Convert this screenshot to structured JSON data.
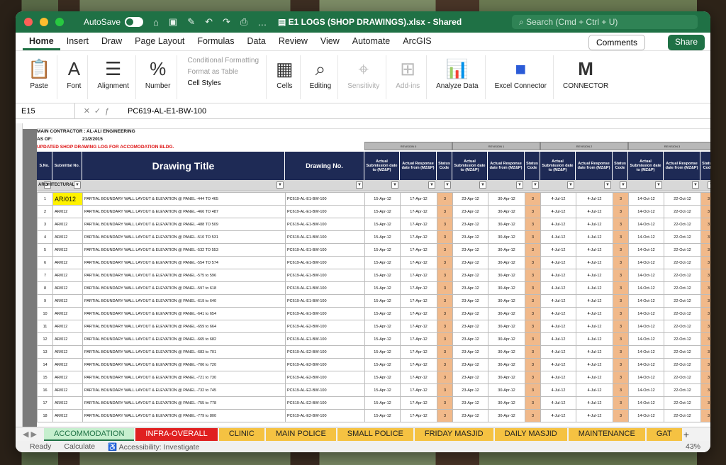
{
  "titlebar": {
    "autosave": "AutoSave",
    "filename": "E1 LOGS (SHOP DRAWINGS).xlsx - Shared",
    "search": "Search (Cmd + Ctrl + U)"
  },
  "menus": [
    "Home",
    "Insert",
    "Draw",
    "Page Layout",
    "Formulas",
    "Data",
    "Review",
    "View",
    "Automate",
    "ArcGIS"
  ],
  "comments": "Comments",
  "share": "Share",
  "ribbon": {
    "paste": "Paste",
    "font": "Font",
    "alignment": "Alignment",
    "number": "Number",
    "cond_fmt": "Conditional Formatting",
    "fmt_table": "Format as Table",
    "cell_styles": "Cell Styles",
    "cells": "Cells",
    "editing": "Editing",
    "sensitivity": "Sensitivity",
    "addins": "Add-ins",
    "analyze": "Analyze Data",
    "excel_conn": "Excel Connector",
    "connector": "CONNECTOR"
  },
  "formula": {
    "name": "E15",
    "value": "PC619-AL-E1-BW-100"
  },
  "sheet": {
    "contractor": "MAIN CONTRACTOR : AL-ALI ENGINEERING",
    "asof_label": "AS OF:",
    "asof": "21/2/2015",
    "updated": "UPDATED SHOP DRAWING LOG FOR ACCOMODATION BLDG.",
    "revisions": [
      "REVISION 0",
      "REVISION 1",
      "REVISION 2",
      "REVISION 3"
    ],
    "headers": {
      "sno": "S.No.",
      "submittal": "Submittal No.",
      "title": "Drawing Title",
      "drawing": "Drawing No.",
      "sub": "Actual Submission date to (MZ&P)",
      "resp": "Actual Response date from (MZ&P)",
      "status": "Status Code"
    },
    "filter_label": "ARCHITECTURAL",
    "rows": [
      [
        "1",
        "AR/012",
        "PARTIAL BOUNDARY WALL LAYOUT & ELEVATION @ PANEL -444 TO 465",
        "PC619-AL-E1-BW-100"
      ],
      [
        "2",
        "AR/012",
        "PARTIAL BOUNDARY WALL LAYOUT & ELEVATION @ PANEL -466 TO 487",
        "PC619-AL-E1-BW-100"
      ],
      [
        "3",
        "AR/012",
        "PARTIAL BOUNDARY WALL LAYOUT & ELEVATION @ PANEL -488 TO 509",
        "PC619-AL-E1-BW-100"
      ],
      [
        "4",
        "AR/012",
        "PARTIAL BOUNDARY WALL LAYOUT & ELEVATION @ PANEL -510 TO 531",
        "PC619-AL-E1-BW-100"
      ],
      [
        "5",
        "AR/012",
        "PARTIAL BOUNDARY WALL LAYOUT & ELEVATION @ PANEL -532 TO 553",
        "PC619-AL-E1-BW-100"
      ],
      [
        "6",
        "AR/012",
        "PARTIAL BOUNDARY WALL LAYOUT & ELEVATION @ PANEL -554 TO 574",
        "PC619-AL-E1-BW-100"
      ],
      [
        "7",
        "AR/012",
        "PARTIAL BOUNDARY WALL LAYOUT & ELEVATION @ PANEL -575 to 596",
        "PC619-AL-E1-BW-100"
      ],
      [
        "8",
        "AR/012",
        "PARTIAL BOUNDARY WALL LAYOUT & ELEVATION @ PANEL -597 to 618",
        "PC619-AL-E1-BW-100"
      ],
      [
        "9",
        "AR/012",
        "PARTIAL BOUNDARY WALL LAYOUT & ELEVATION @ PANEL -619 to 640",
        "PC619-AL-E1-BW-100"
      ],
      [
        "10",
        "AR/012",
        "PARTIAL BOUNDARY WALL LAYOUT & ELEVATION @ PANEL -641 to 654",
        "PC619-AL-E1-BW-100"
      ],
      [
        "11",
        "AR/012",
        "PARTIAL BOUNDARY WALL LAYOUT & ELEVATION @ PANEL -659 to 664",
        "PC619-AL-E2-BW-100"
      ],
      [
        "12",
        "AR/012",
        "PARTIAL BOUNDARY WALL LAYOUT & ELEVATION @ PANEL -665 to 682",
        "PC619-AL-E1-BW-100"
      ],
      [
        "13",
        "AR/012",
        "PARTIAL BOUNDARY WALL LAYOUT & ELEVATION @ PANEL -683 to 701",
        "PC619-AL-E2-BW-100"
      ],
      [
        "14",
        "AR/012",
        "PARTIAL BOUNDARY WALL LAYOUT & ELEVATION @ PANEL -706 to 720",
        "PC619-AL-E2-BW-100"
      ],
      [
        "15",
        "AR/012",
        "PARTIAL BOUNDARY WALL LAYOUT & ELEVATION @ PANEL -721 to 730",
        "PC619-AL-E2-BW-100"
      ],
      [
        "16",
        "AR/012",
        "PARTIAL BOUNDARY WALL LAYOUT & ELEVATION @ PANEL -732 to 745",
        "PC619-AL-E2-BW-100"
      ],
      [
        "17",
        "AR/012",
        "PARTIAL BOUNDARY WALL LAYOUT & ELEVATION @ PANEL -755 to 778",
        "PC619-AL-E2-BW-100"
      ],
      [
        "18",
        "AR/012",
        "PARTIAL BOUNDARY WALL LAYOUT & ELEVATION @ PANEL -779 to 800",
        "PC619-AL-E2-BW-100"
      ]
    ],
    "rev_values": [
      [
        "15-Apr-12",
        "17-Apr-12",
        "3"
      ],
      [
        "23-Apr-12",
        "30-Apr-12",
        "3"
      ],
      [
        "4-Jul-12",
        "4-Jul-12",
        "3"
      ],
      [
        "14-Oct-12",
        "22-Oct-12",
        "3"
      ]
    ]
  },
  "tabs": [
    "ACCOMMODATION",
    "INFRA-OVERALL",
    "CLINIC",
    "MAIN POLICE",
    "SMALL POLICE",
    "FRIDAY MASJID",
    "DAILY MASJID",
    "MAINTENANCE",
    "GAT"
  ],
  "tab_colors": [
    "#c6efce",
    "#e02020",
    "#f5c242",
    "#f5c242",
    "#f5c242",
    "#f5c242",
    "#f5c242",
    "#f5c242",
    "#f5c242"
  ],
  "status": {
    "ready": "Ready",
    "calc": "Calculate",
    "access": "Accessibility: Investigate",
    "zoom": "43%"
  }
}
